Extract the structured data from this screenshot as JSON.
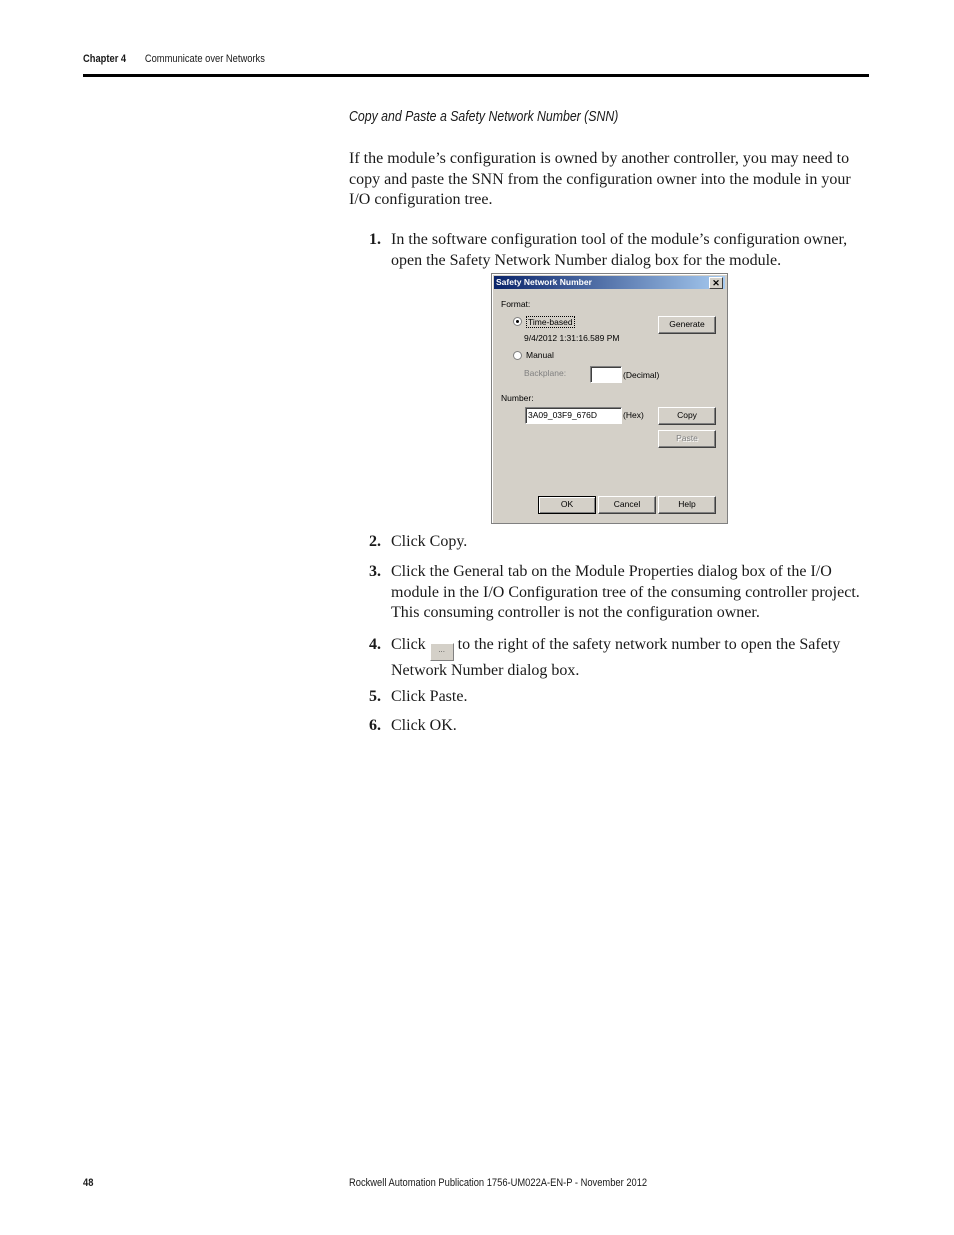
{
  "header": {
    "chapter": "Chapter 4",
    "title": "Communicate over Networks"
  },
  "section_title": "Copy and Paste a Safety Network Number (SNN)",
  "intro": "If the module’s configuration is owned by another controller, you may need to copy and paste the SNN from the configuration owner into the module in your I/O configuration tree.",
  "steps": [
    {
      "num": "1.",
      "text": "In the software configuration tool of the module’s configuration owner, open the Safety Network Number dialog box for the module."
    },
    {
      "num": "2.",
      "text": "Click Copy."
    },
    {
      "num": "3.",
      "text": "Click the General tab on the Module Properties dialog box of the I/O module in the I/O Configuration tree of the consuming controller project. This consuming controller is not the configuration owner."
    },
    {
      "num": "4.",
      "text_before": "Click",
      "inline_button_label": "...",
      "text_after": "to the right of the safety network number to open the Safety Network Number dialog box."
    },
    {
      "num": "5.",
      "text": "Click Paste."
    },
    {
      "num": "6.",
      "text": "Click OK."
    }
  ],
  "dialog": {
    "title": "Safety Network Number",
    "close_glyph": "✕",
    "format_label": "Format:",
    "time_based_label": "Time-based",
    "time_based_selected": true,
    "timestamp": "9/4/2012 1:31:16.589 PM",
    "manual_label": "Manual",
    "backplane_label": "Backplane:",
    "backplane_value": "",
    "decimal_label": "(Decimal)",
    "number_label": "Number:",
    "number_value": "3A09_03F9_676D",
    "hex_label": "(Hex)",
    "buttons": {
      "generate": "Generate",
      "copy": "Copy",
      "paste": "Paste",
      "ok": "OK",
      "cancel": "Cancel",
      "help": "Help"
    }
  },
  "footer": {
    "page_number": "48",
    "publication": "Rockwell Automation Publication 1756-UM022A-EN-P - November 2012"
  }
}
